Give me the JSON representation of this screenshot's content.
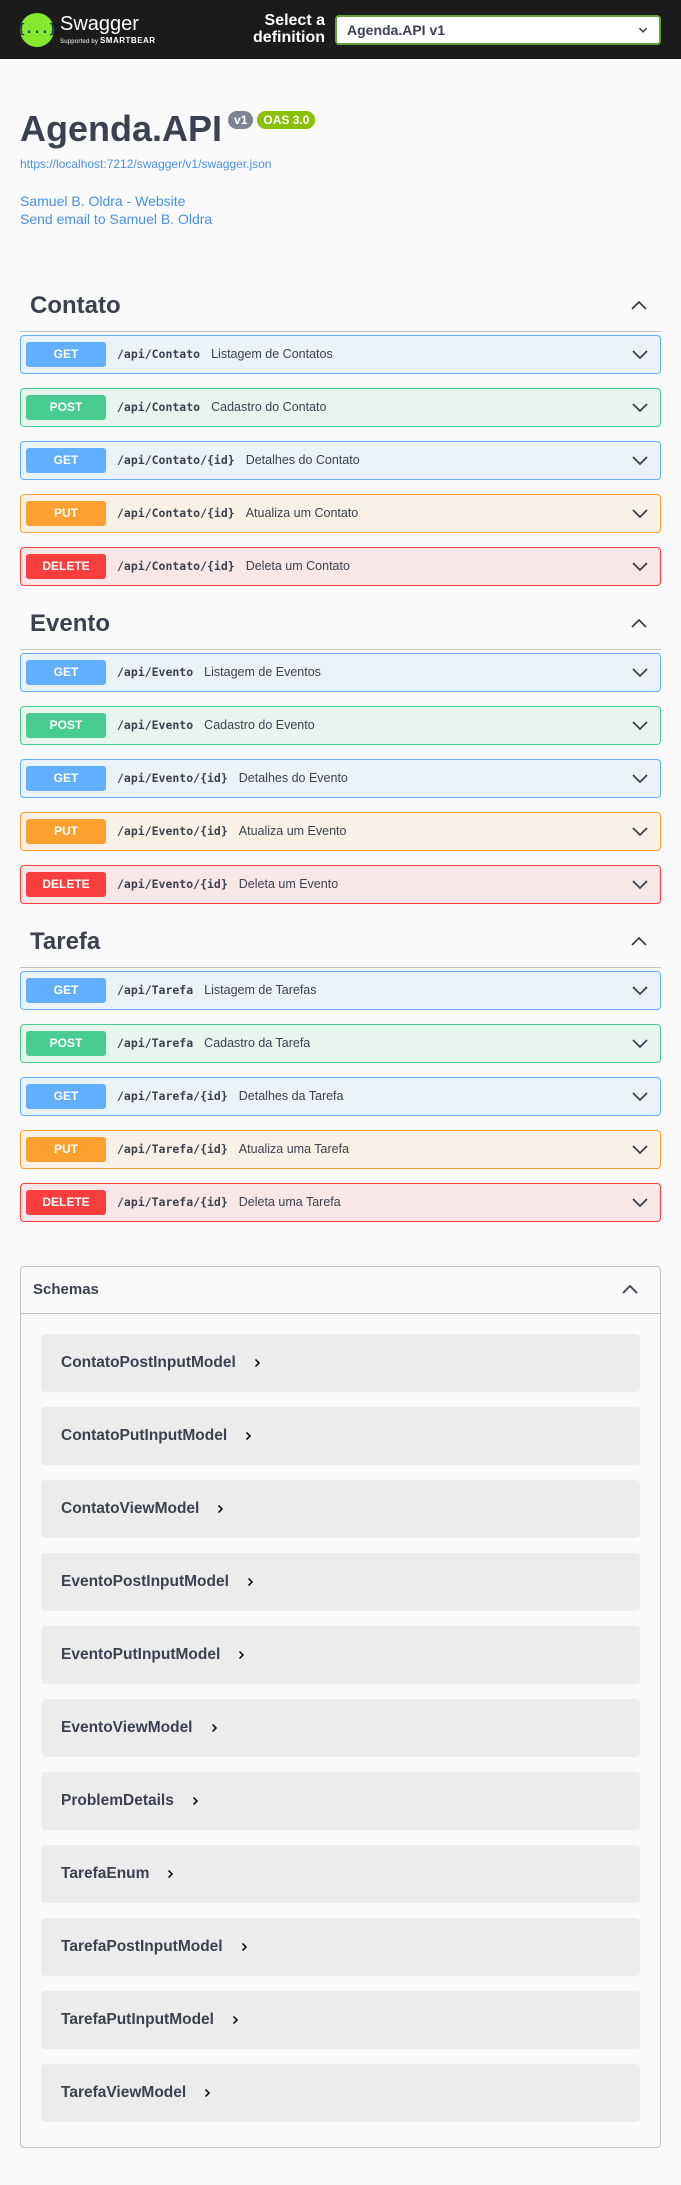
{
  "topbar": {
    "logo_glyph": "{...}",
    "brand_name": "Swagger",
    "brand_sub_prefix": "Supported by",
    "brand_sub_company": "SMARTBEAR",
    "definition_label_line1": "Select a",
    "definition_label_line2": "definition",
    "definition_selected": "Agenda.API v1",
    "accent_color": "#85ea2d"
  },
  "info": {
    "title": "Agenda.API",
    "version_badge": "v1",
    "oas_badge": "OAS 3.0",
    "spec_url": "https://localhost:7212/swagger/v1/swagger.json",
    "contact_website": "Samuel B. Oldra - Website",
    "contact_email": "Send email to Samuel B. Oldra"
  },
  "tags": [
    {
      "name": "Contato",
      "operations": [
        {
          "method": "GET",
          "path": "/api/Contato",
          "summary": "Listagem de Contatos"
        },
        {
          "method": "POST",
          "path": "/api/Contato",
          "summary": "Cadastro do Contato"
        },
        {
          "method": "GET",
          "path": "/api/Contato/{id}",
          "summary": "Detalhes do Contato"
        },
        {
          "method": "PUT",
          "path": "/api/Contato/{id}",
          "summary": "Atualiza um Contato"
        },
        {
          "method": "DELETE",
          "path": "/api/Contato/{id}",
          "summary": "Deleta um Contato"
        }
      ]
    },
    {
      "name": "Evento",
      "operations": [
        {
          "method": "GET",
          "path": "/api/Evento",
          "summary": "Listagem de Eventos"
        },
        {
          "method": "POST",
          "path": "/api/Evento",
          "summary": "Cadastro do Evento"
        },
        {
          "method": "GET",
          "path": "/api/Evento/{id}",
          "summary": "Detalhes do Evento"
        },
        {
          "method": "PUT",
          "path": "/api/Evento/{id}",
          "summary": "Atualiza um Evento"
        },
        {
          "method": "DELETE",
          "path": "/api/Evento/{id}",
          "summary": "Deleta um Evento"
        }
      ]
    },
    {
      "name": "Tarefa",
      "operations": [
        {
          "method": "GET",
          "path": "/api/Tarefa",
          "summary": "Listagem de Tarefas"
        },
        {
          "method": "POST",
          "path": "/api/Tarefa",
          "summary": "Cadastro da Tarefa"
        },
        {
          "method": "GET",
          "path": "/api/Tarefa/{id}",
          "summary": "Detalhes da Tarefa"
        },
        {
          "method": "PUT",
          "path": "/api/Tarefa/{id}",
          "summary": "Atualiza uma Tarefa"
        },
        {
          "method": "DELETE",
          "path": "/api/Tarefa/{id}",
          "summary": "Deleta uma Tarefa"
        }
      ]
    }
  ],
  "method_colors": {
    "GET": "#61affe",
    "POST": "#49cc90",
    "PUT": "#fca130",
    "DELETE": "#f93e3e"
  },
  "schemas": {
    "title": "Schemas",
    "models": [
      "ContatoPostInputModel",
      "ContatoPutInputModel",
      "ContatoViewModel",
      "EventoPostInputModel",
      "EventoPutInputModel",
      "EventoViewModel",
      "ProblemDetails",
      "TarefaEnum",
      "TarefaPostInputModel",
      "TarefaPutInputModel",
      "TarefaViewModel"
    ]
  }
}
